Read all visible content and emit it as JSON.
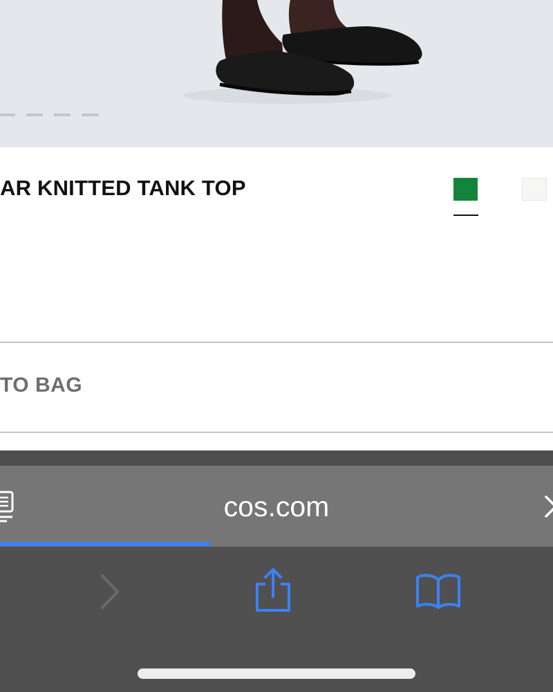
{
  "product": {
    "title": "AR KNITTED TANK TOP",
    "image_dots": 4,
    "swatches": [
      {
        "name": "green",
        "color": "#14843c",
        "selected": true
      },
      {
        "name": "off-white",
        "color": "#f6f6f4",
        "selected": false
      }
    ],
    "add_to_bag_label": "TO BAG"
  },
  "browser": {
    "url": "cos.com",
    "load_progress": 0.38,
    "accent_color": "#3b82f6",
    "icons": {
      "reader": "reader-mode-icon",
      "close": "close-icon",
      "forward": "forward-chevron-icon",
      "share": "share-icon",
      "bookmarks": "bookmarks-book-icon"
    }
  }
}
